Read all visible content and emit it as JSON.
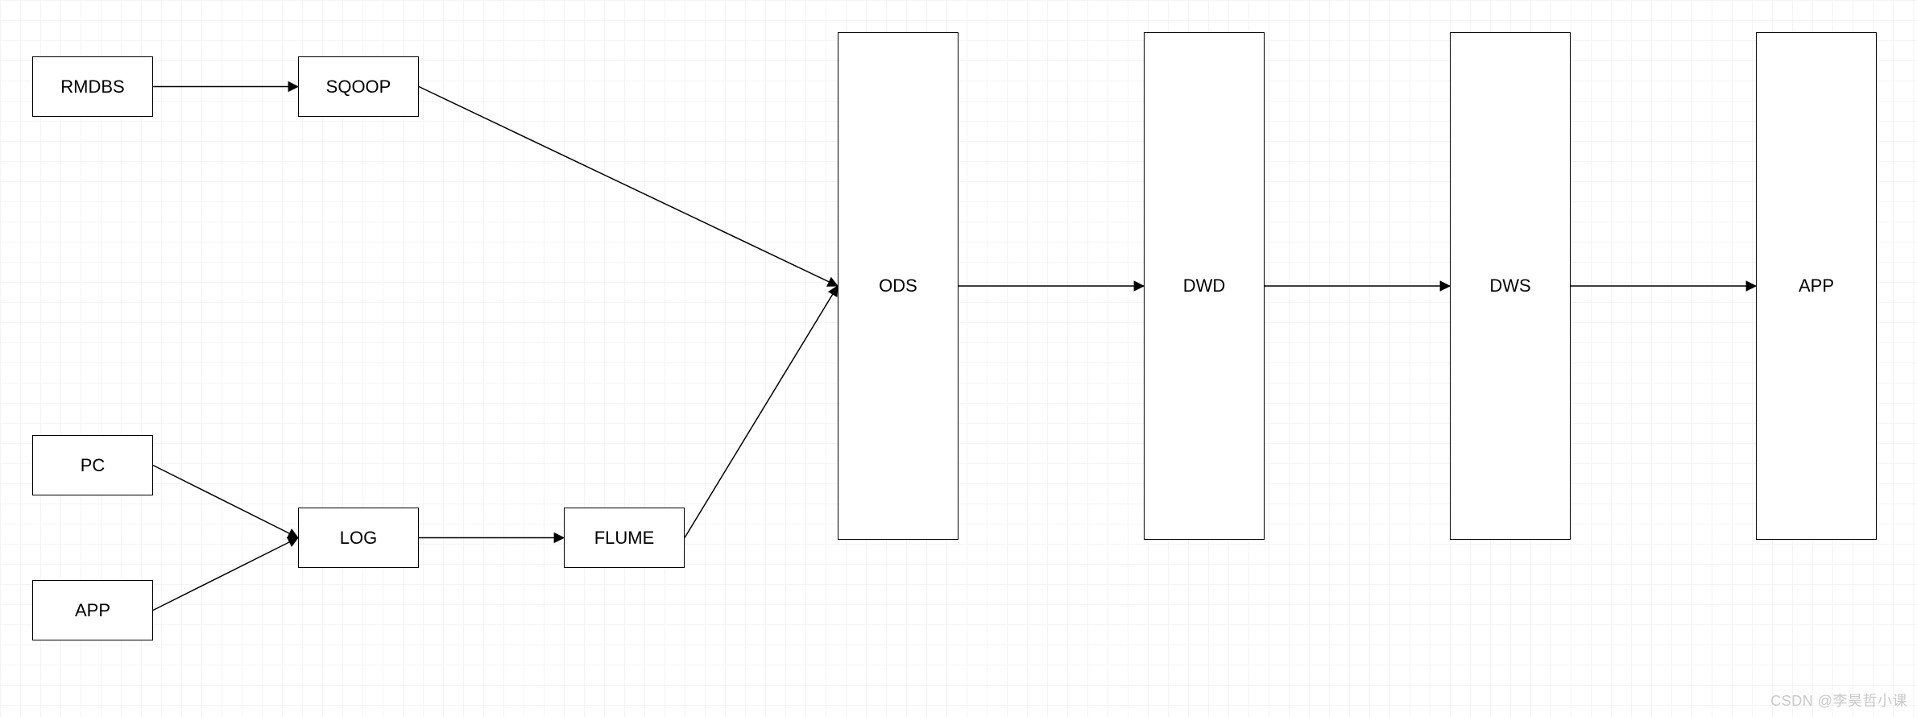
{
  "nodes": {
    "rmdbs": {
      "label": "RMDBS"
    },
    "sqoop": {
      "label": "SQOOP"
    },
    "pc": {
      "label": "PC"
    },
    "app_src": {
      "label": "APP"
    },
    "log": {
      "label": "LOG"
    },
    "flume": {
      "label": "FLUME"
    },
    "ods": {
      "label": "ODS"
    },
    "dwd": {
      "label": "DWD"
    },
    "dws": {
      "label": "DWS"
    },
    "app_out": {
      "label": "APP"
    }
  },
  "edges": [
    {
      "from": "rmdbs",
      "to": "sqoop"
    },
    {
      "from": "pc",
      "to": "log"
    },
    {
      "from": "app_src",
      "to": "log"
    },
    {
      "from": "log",
      "to": "flume"
    },
    {
      "from": "sqoop",
      "to": "ods"
    },
    {
      "from": "flume",
      "to": "ods"
    },
    {
      "from": "ods",
      "to": "dwd"
    },
    {
      "from": "dwd",
      "to": "dws"
    },
    {
      "from": "dws",
      "to": "app_out"
    }
  ],
  "watermark": "CSDN @李昊哲小课"
}
